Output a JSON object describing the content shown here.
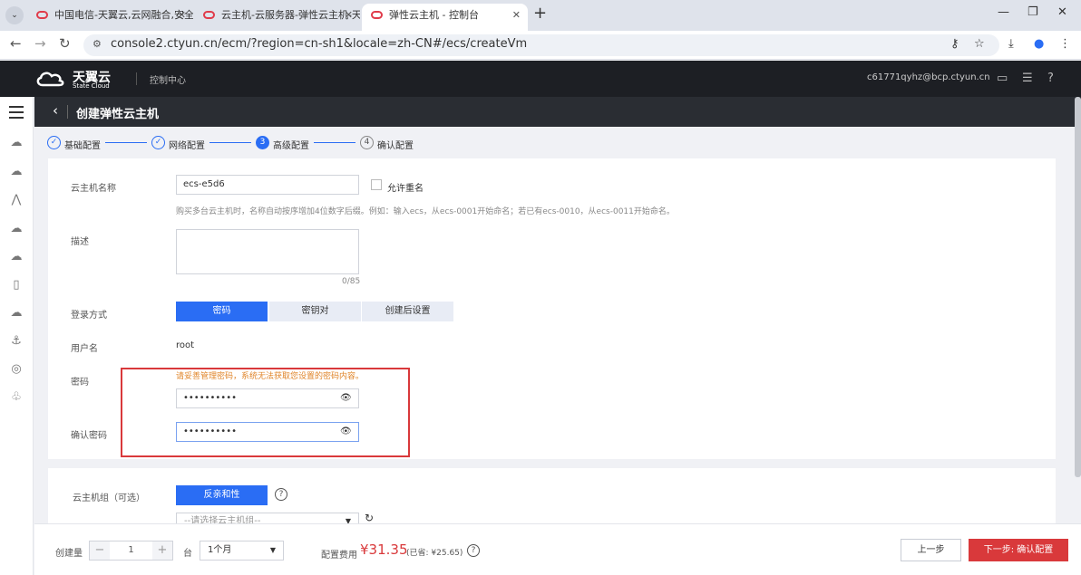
{
  "browser": {
    "tabs": [
      {
        "label": "中国电信-天翼云,云网融合,安全..."
      },
      {
        "label": "云主机-云服务器-弹性云主机-天..."
      },
      {
        "label": "弹性云主机 - 控制台"
      }
    ],
    "url": "console2.ctyun.cn/ecm/?region=cn-sh1&locale=zh-CN#/ecs/createVm"
  },
  "header": {
    "logo_name": "天翼云",
    "logo_sub": "State Cloud",
    "console_label": "控制中心",
    "user": "c61771qyhz@bcp.ctyun.cn"
  },
  "page": {
    "title": "创建弹性云主机"
  },
  "steps": [
    {
      "num": "✓",
      "label": "基础配置"
    },
    {
      "num": "✓",
      "label": "网络配置"
    },
    {
      "num": "3",
      "label": "高级配置"
    },
    {
      "num": "4",
      "label": "确认配置"
    }
  ],
  "form": {
    "name_label": "云主机名称",
    "name_value": "ecs-e5d6",
    "allow_dup_label": "允许重名",
    "name_hint": "购买多台云主机时，名称自动按序增加4位数字后缀。例如：输入ecs，从ecs-0001开始命名；若已有ecs-0010，从ecs-0011开始命名。",
    "desc_label": "描述",
    "desc_count": "0/85",
    "login_label": "登录方式",
    "login_options": [
      "密码",
      "密钥对",
      "创建后设置"
    ],
    "user_label": "用户名",
    "user_value": "root",
    "pwd_label": "密码",
    "pwd_warning": "请妥善管理密码，系统无法获取您设置的密码内容。",
    "pwd_value": "••••••••••",
    "confirm_label": "确认密码",
    "confirm_value": "••••••••••",
    "group_label": "云主机组（可选）",
    "group_button": "反亲和性",
    "group_placeholder": "--请选择云主机组--"
  },
  "footer": {
    "count_label": "创建量",
    "count_value": "1",
    "unit": "台",
    "duration": "1个月",
    "fee_label": "配置费用",
    "price": "¥31.35",
    "saved": "(已省: ¥25.65)",
    "prev_label": "上一步",
    "next_label": "下一步: 确认配置"
  }
}
